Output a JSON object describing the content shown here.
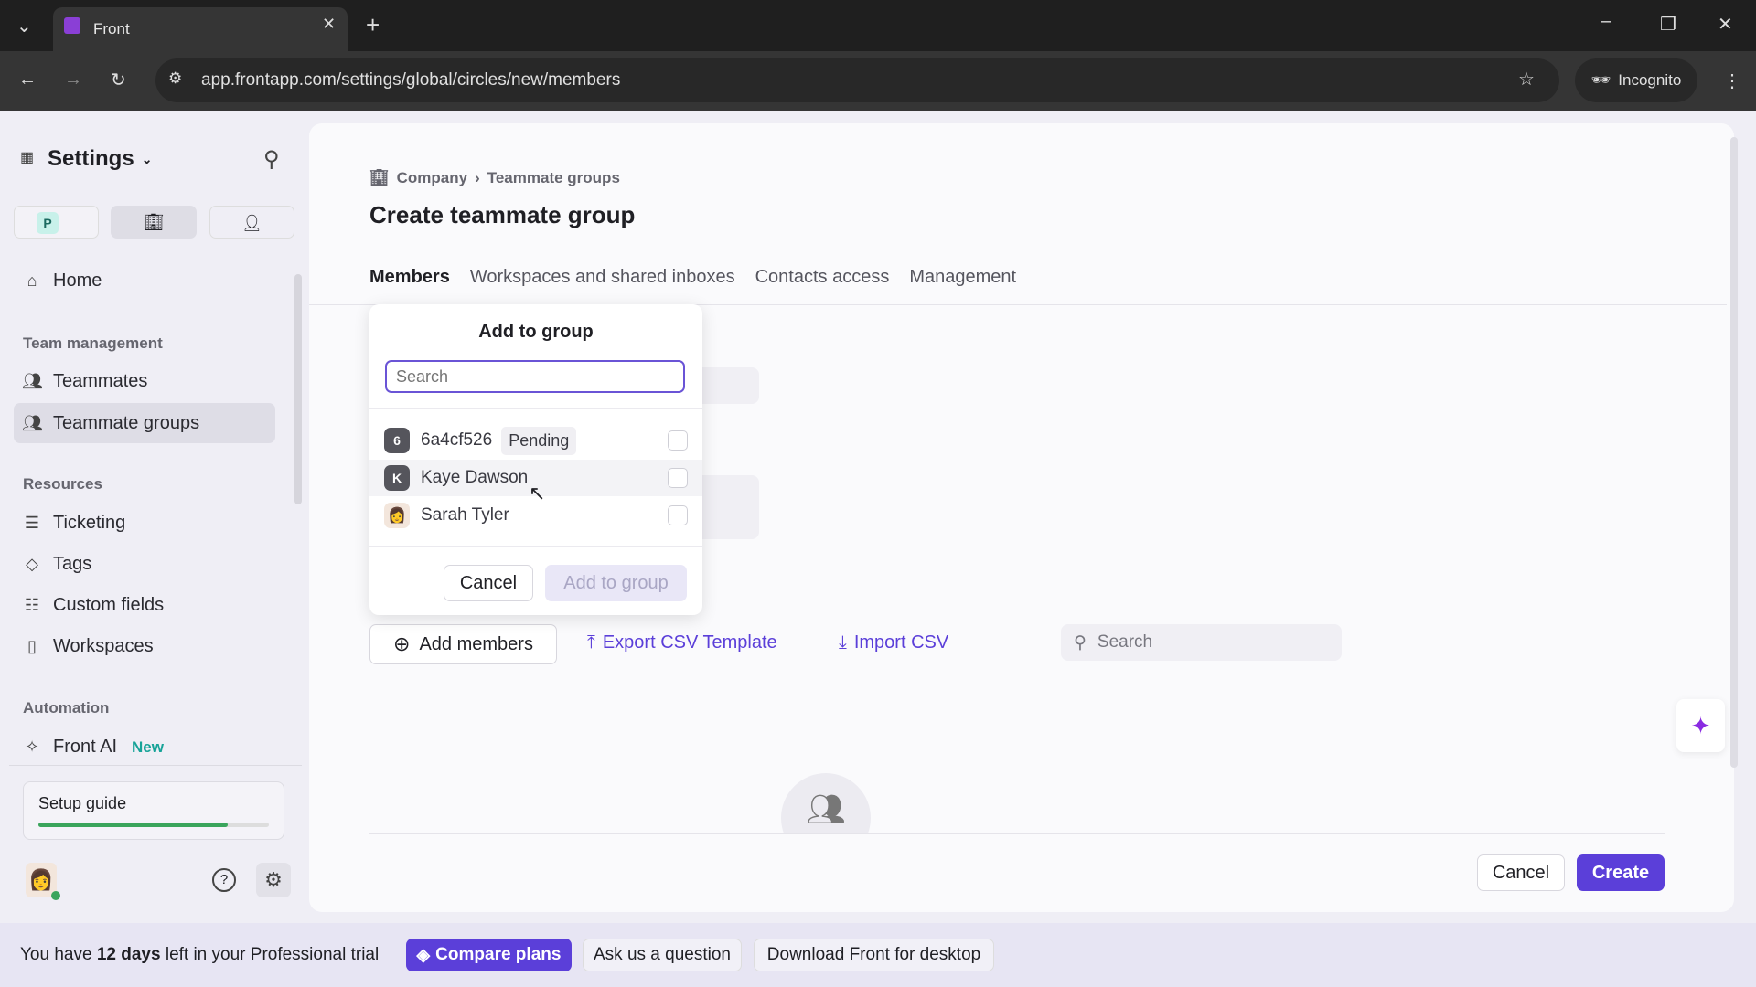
{
  "browser": {
    "tab_title": "Front",
    "url": "app.frontapp.com/settings/global/circles/new/members",
    "incognito": "Incognito"
  },
  "sidebar": {
    "title": "Settings",
    "workspace_badge": "P",
    "items": [
      {
        "label": "Home"
      },
      {
        "section": "Team management"
      },
      {
        "label": "Teammates"
      },
      {
        "label": "Teammate groups",
        "selected": true
      },
      {
        "section": "Resources"
      },
      {
        "label": "Ticketing"
      },
      {
        "label": "Tags"
      },
      {
        "label": "Custom fields"
      },
      {
        "label": "Workspaces"
      },
      {
        "section": "Automation"
      },
      {
        "label": "Front AI",
        "badge": "New"
      }
    ],
    "setup_guide": {
      "label": "Setup guide",
      "progress": 0.82
    }
  },
  "main": {
    "breadcrumb": [
      "Company",
      "Teammate groups"
    ],
    "title": "Create teammate group",
    "tabs": [
      "Members",
      "Workspaces and shared inboxes",
      "Contacts access",
      "Management"
    ],
    "actions": {
      "add_members": "Add members",
      "export": "Export CSV Template",
      "import": "Import CSV",
      "search_placeholder": "Search"
    },
    "footer": {
      "cancel": "Cancel",
      "create": "Create"
    }
  },
  "popup": {
    "title": "Add to group",
    "search_placeholder": "Search",
    "members": [
      {
        "initial": "6",
        "name": "6a4cf526",
        "badge": "Pending"
      },
      {
        "initial": "K",
        "name": "Kaye Dawson"
      },
      {
        "initial": "",
        "name": "Sarah Tyler"
      }
    ],
    "cancel": "Cancel",
    "add": "Add to group"
  },
  "banner": {
    "pre": "You have ",
    "days": "12 days",
    "post": " left in your Professional trial",
    "compare": "Compare plans",
    "ask": "Ask us a question",
    "download": "Download Front for desktop"
  },
  "colors": {
    "accent": "#5b3fd9",
    "progress": "#3aa55c"
  }
}
